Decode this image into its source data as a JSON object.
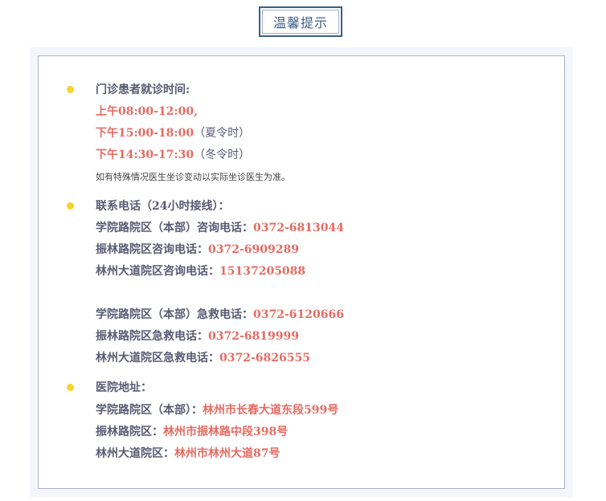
{
  "header": {
    "title": "温馨提示"
  },
  "hours": {
    "heading": "门诊患者就诊时间:",
    "morning": "上午08:00-12:00,",
    "afternoon_summer": "下午15:00-18:00",
    "summer_note": "（夏令时）",
    "afternoon_winter": "下午14:30-17:30",
    "winter_note": "（冬令时）",
    "notice": "如有特殊情况医生坐诊变动以实际坐诊医生为准。"
  },
  "phones": {
    "heading": "联系电话（24小时接线）：",
    "consult": [
      {
        "label": "学院路院区（本部）咨询电话：",
        "value": "0372-6813044"
      },
      {
        "label": "振林路院区咨询电话：",
        "value": "0372-6909289"
      },
      {
        "label": "林州大道院区咨询电话：",
        "value": "15137205088"
      }
    ],
    "emergency": [
      {
        "label": "学院路院区（本部）急救电话：",
        "value": "0372-6120666"
      },
      {
        "label": "振林路院区急救电话：",
        "value": "0372-6819999"
      },
      {
        "label": "林州大道院区急救电话：",
        "value": "0372-6826555"
      }
    ]
  },
  "address": {
    "heading": "医院地址：",
    "items": [
      {
        "label": "学院路院区（本部）：",
        "value": "林州市长春大道东段599号"
      },
      {
        "label": "振林路院区：",
        "value": "林州市振林路中段398号"
      },
      {
        "label": "林州大道院区：",
        "value": "林州市林州大道87号"
      }
    ]
  },
  "colors": {
    "accent_red": "#e56b62",
    "bullet": "#f5d327",
    "title_border": "#3a5f8a"
  }
}
